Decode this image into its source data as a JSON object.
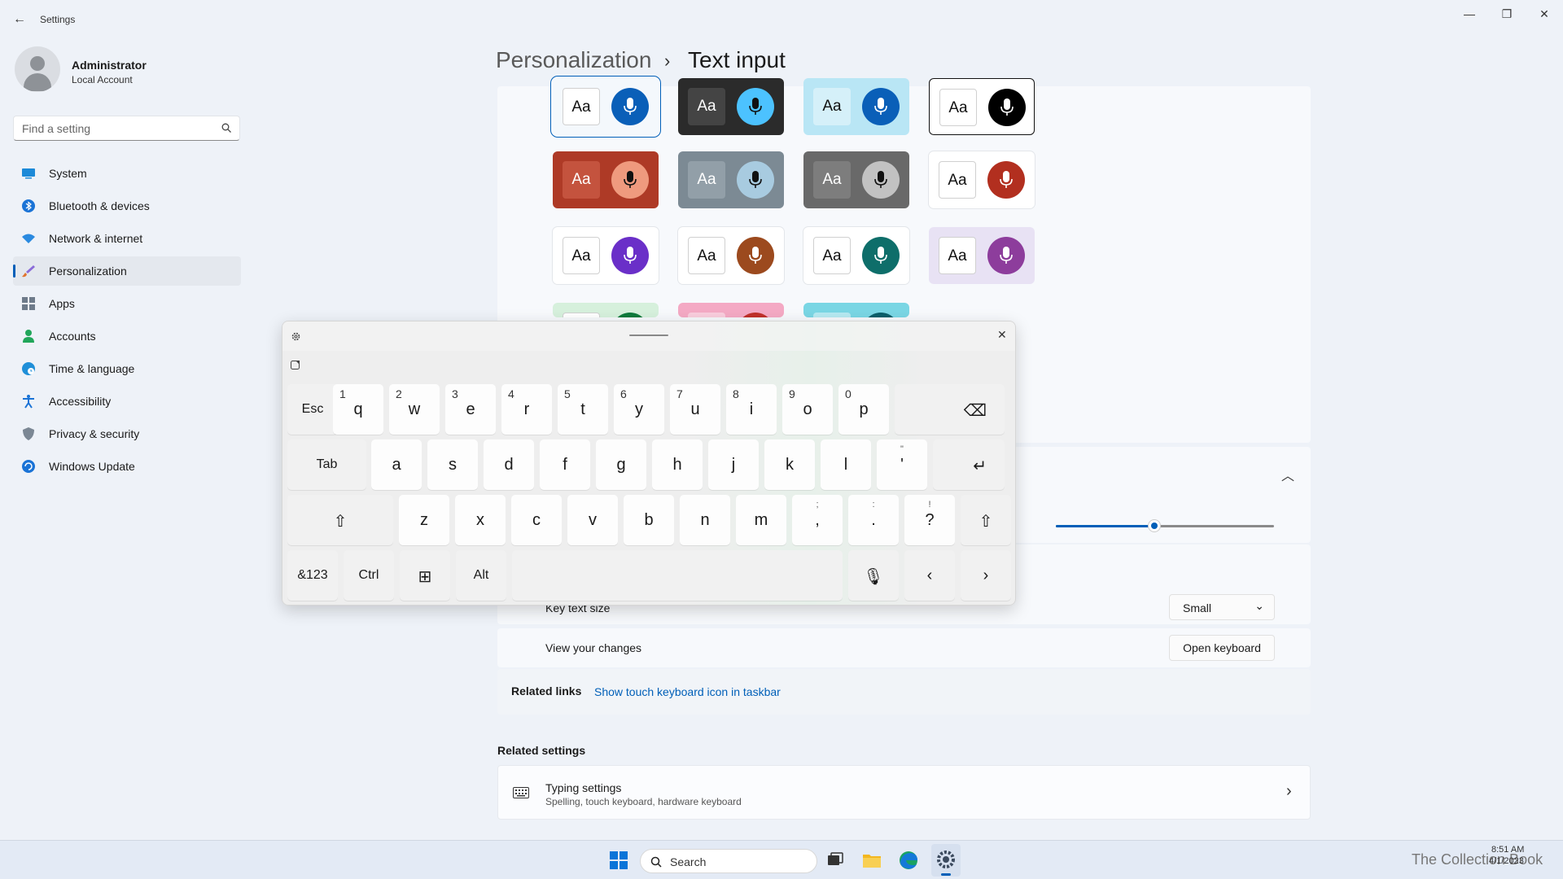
{
  "window": {
    "title": "Settings",
    "back_glyph": "←",
    "minimize_glyph": "—",
    "maximize_glyph": "❐",
    "close_glyph": "✕"
  },
  "user": {
    "name": "Administrator",
    "account_type": "Local Account"
  },
  "search": {
    "placeholder": "Find a setting",
    "icon": "search-icon"
  },
  "nav": {
    "items": [
      {
        "label": "System",
        "icon": "system-icon"
      },
      {
        "label": "Bluetooth & devices",
        "icon": "bluetooth-icon"
      },
      {
        "label": "Network & internet",
        "icon": "wifi-icon"
      },
      {
        "label": "Personalization",
        "icon": "brush-icon",
        "active": true
      },
      {
        "label": "Apps",
        "icon": "apps-icon"
      },
      {
        "label": "Accounts",
        "icon": "accounts-icon"
      },
      {
        "label": "Time & language",
        "icon": "globe-clock-icon"
      },
      {
        "label": "Accessibility",
        "icon": "accessibility-icon"
      },
      {
        "label": "Privacy & security",
        "icon": "shield-icon"
      },
      {
        "label": "Windows Update",
        "icon": "update-icon"
      }
    ]
  },
  "header": {
    "parent": "Personalization",
    "separator": "›",
    "current": "Text input"
  },
  "themes": {
    "aa_label": "Aa",
    "tiles": [
      {
        "bg": "#f4f8fc",
        "aa_bg": "#ffffff",
        "aa_fg": "#111111",
        "mic_bg": "#0a5fb8",
        "mic_fg": "#ffffff",
        "selected": true
      },
      {
        "bg": "#2b2b2b",
        "aa_bg": "#444444",
        "aa_fg": "#ffffff",
        "mic_bg": "#4cc2ff",
        "mic_fg": "#111111"
      },
      {
        "bg": "#b9e6f5",
        "aa_bg": "#d5f0f9",
        "aa_fg": "#111111",
        "mic_bg": "#0a5fb8",
        "mic_fg": "#ffffff"
      },
      {
        "bg": "#ffffff",
        "aa_bg": "#ffffff",
        "aa_fg": "#111111",
        "mic_bg": "#000000",
        "mic_fg": "#ffffff",
        "outlined": true
      },
      {
        "bg": "#ae3a26",
        "aa_bg": "#c4533e",
        "aa_fg": "#ffffff",
        "mic_bg": "#ef9a7e",
        "mic_fg": "#111111"
      },
      {
        "bg": "#7c8a94",
        "aa_bg": "#929fa8",
        "aa_fg": "#ffffff",
        "mic_bg": "#a8cbe0",
        "mic_fg": "#111111"
      },
      {
        "bg": "#696969",
        "aa_bg": "#7d7d7d",
        "aa_fg": "#ffffff",
        "mic_bg": "#c2c2c2",
        "mic_fg": "#111111"
      },
      {
        "bg": "#ffffff",
        "aa_bg": "#ffffff",
        "aa_fg": "#111111",
        "mic_bg": "#b22f1f",
        "mic_fg": "#ffffff"
      },
      {
        "bg": "#ffffff",
        "aa_bg": "#ffffff",
        "aa_fg": "#111111",
        "mic_bg": "#6a2fc8",
        "mic_fg": "#ffffff"
      },
      {
        "bg": "#ffffff",
        "aa_bg": "#ffffff",
        "aa_fg": "#111111",
        "mic_bg": "#9c4a1e",
        "mic_fg": "#ffffff"
      },
      {
        "bg": "#ffffff",
        "aa_bg": "#ffffff",
        "aa_fg": "#111111",
        "mic_bg": "#0e6e6a",
        "mic_fg": "#ffffff"
      },
      {
        "bg": "#e8e2f4",
        "aa_bg": "#ffffff",
        "aa_fg": "#111111",
        "mic_bg": "#8d3d9c",
        "mic_fg": "#ffffff"
      },
      {
        "bg": "#d6f0dc",
        "aa_bg": "#ffffff",
        "aa_fg": "#111111",
        "mic_bg": "#0e7a3c",
        "mic_fg": "#ffffff"
      },
      {
        "bg": "#f4a9c4",
        "aa_bg": "#f9cddd",
        "aa_fg": "#111111",
        "mic_bg": "#c0302a",
        "mic_fg": "#ffffff"
      },
      {
        "bg": "#7ad6e4",
        "aa_bg": "#b6e9f1",
        "aa_fg": "#111111",
        "mic_bg": "#0b5e6a",
        "mic_fg": "#ffffff"
      }
    ]
  },
  "keyboard_settings": {
    "size_slider_fraction": 0.45,
    "key_text_size_label": "Key text size",
    "key_text_size_value": "Small",
    "dropdown_glyph": "⌄",
    "collapse_glyph": "︿",
    "view_changes_label": "View your changes",
    "open_keyboard_button": "Open keyboard"
  },
  "related_links": {
    "label": "Related links",
    "link": "Show touch keyboard icon in taskbar"
  },
  "related_settings": {
    "heading": "Related settings",
    "typing_title": "Typing settings",
    "typing_subtitle": "Spelling, touch keyboard, hardware keyboard",
    "chevron_glyph": "›"
  },
  "touch_keyboard": {
    "rows": [
      [
        {
          "main": "Esc",
          "small": true
        },
        {
          "main": "q",
          "num": "1"
        },
        {
          "main": "w",
          "num": "2"
        },
        {
          "main": "e",
          "num": "3"
        },
        {
          "main": "r",
          "num": "4"
        },
        {
          "main": "t",
          "num": "5"
        },
        {
          "main": "y",
          "num": "6"
        },
        {
          "main": "u",
          "num": "7"
        },
        {
          "main": "i",
          "num": "8"
        },
        {
          "main": "o",
          "num": "9"
        },
        {
          "main": "p",
          "num": "0"
        },
        {
          "main": "⌫",
          "name": "backspace-key"
        }
      ],
      [
        {
          "main": "Tab",
          "small": true
        },
        {
          "main": "a"
        },
        {
          "main": "s"
        },
        {
          "main": "d"
        },
        {
          "main": "f"
        },
        {
          "main": "g"
        },
        {
          "main": "h"
        },
        {
          "main": "j"
        },
        {
          "main": "k"
        },
        {
          "main": "l"
        },
        {
          "main": "'",
          "sub": "\""
        },
        {
          "main": "↵",
          "name": "enter-key"
        }
      ],
      [
        {
          "main": "⇧",
          "name": "shift-key"
        },
        {
          "main": "z"
        },
        {
          "main": "x"
        },
        {
          "main": "c"
        },
        {
          "main": "v"
        },
        {
          "main": "b"
        },
        {
          "main": "n"
        },
        {
          "main": "m"
        },
        {
          "main": ",",
          "sub": ";"
        },
        {
          "main": ".",
          "sub": ":"
        },
        {
          "main": "?",
          "sub": "!"
        },
        {
          "main": "⇧",
          "name": "shift-key-right"
        }
      ],
      [
        {
          "main": "&123",
          "small": true
        },
        {
          "main": "Ctrl",
          "small": true
        },
        {
          "main": "⊞",
          "name": "windows-key"
        },
        {
          "main": "Alt",
          "small": true
        },
        {
          "main": "",
          "name": "space-key"
        },
        {
          "main": "🎙",
          "name": "mic-key"
        },
        {
          "main": "‹",
          "name": "left-arrow-key"
        },
        {
          "main": "›",
          "name": "right-arrow-key"
        }
      ]
    ]
  },
  "taskbar": {
    "search_label": "Search",
    "time": "8:51 AM",
    "date": "4/1/2023",
    "watermark": "The Collection Book"
  },
  "colors": {
    "accent": "#005fb8",
    "background": "#eef2f8",
    "card": "#f7f9fc"
  }
}
